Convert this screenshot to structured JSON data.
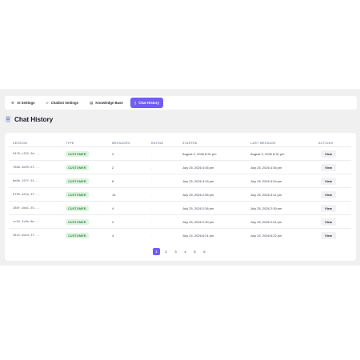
{
  "tabs": [
    {
      "label": "AI Settings",
      "icon": "robot-icon",
      "glyph": "⚙"
    },
    {
      "label": "Chatbot Settings",
      "icon": "code-icon",
      "glyph": "‹›"
    },
    {
      "label": "Knowledge Base",
      "icon": "book-icon",
      "glyph": "▤"
    },
    {
      "label": "Chat History",
      "icon": "document-icon",
      "glyph": "▯"
    }
  ],
  "active_tab": "Chat History",
  "page": {
    "title": "Chat History"
  },
  "table": {
    "headers": [
      "SESSION",
      "TYPE",
      "MESSAGES",
      "RATING",
      "STARTED",
      "LAST MESSAGE",
      "ACTIONS"
    ],
    "rows": [
      {
        "session": "9476-c332-3d...",
        "type": "CUSTOMER",
        "messages": "2",
        "rating": "-",
        "started": "August 2, 2026 8:31 pm",
        "last": "August 2, 2026 8:31 pm"
      },
      {
        "session": "f6b8-4b95-67...",
        "type": "CUSTOMER",
        "messages": "2",
        "rating": "-",
        "started": "July 25, 2026 4:36 pm",
        "last": "July 25, 2026 4:36 pm"
      },
      {
        "session": "be6b-197f-91...",
        "type": "CUSTOMER",
        "messages": "8",
        "rating": "-",
        "started": "July 25, 2026 4:15 pm",
        "last": "July 25, 2026 4:34 pm"
      },
      {
        "session": "6799-a92a-37...",
        "type": "CUSTOMER",
        "messages": "10",
        "rating": "-",
        "started": "July 25, 2026 2:56 pm",
        "last": "July 25, 2026 3:11 pm"
      },
      {
        "session": "280f-4bb1-35...",
        "type": "CUSTOMER",
        "messages": "4",
        "rating": "-",
        "started": "July 25, 2026 2:36 pm",
        "last": "July 25, 2026 2:39 pm"
      },
      {
        "session": "cc94-3c8e-8e...",
        "type": "CUSTOMER",
        "messages": "2",
        "rating": "-",
        "started": "July 25, 2026 2:30 pm",
        "last": "July 25, 2026 2:31 pm"
      },
      {
        "session": "48c5-4be4-37...",
        "type": "CUSTOMER",
        "messages": "4",
        "rating": "-",
        "started": "July 24, 2026 6:21 pm",
        "last": "July 24, 2026 6:22 pm"
      }
    ],
    "action_label": "View"
  },
  "pagination": {
    "pages": [
      "1",
      "2",
      "3",
      "4",
      "5",
      "6"
    ],
    "current": "1"
  },
  "colors": {
    "accent": "#6f5df4",
    "badge_bg": "#dff4e1",
    "badge_text": "#2f8b43",
    "panel_bg": "#f0f0f1"
  }
}
